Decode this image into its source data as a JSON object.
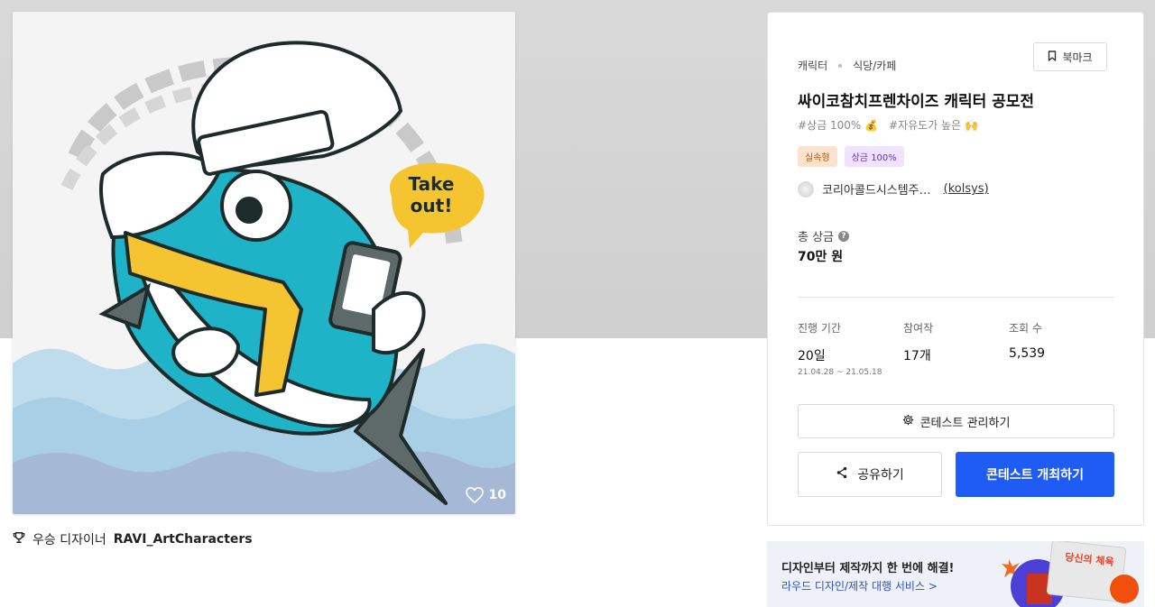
{
  "artwork": {
    "speech_bubble": "Take\nout!",
    "like_count": "10"
  },
  "winner": {
    "label": "우승 디자이너",
    "name": "RAVI_ArtCharacters"
  },
  "panel": {
    "categories": [
      "캐릭터",
      "식당/카페"
    ],
    "bookmark_label": "북마크",
    "title": "싸이코참치프렌차이즈 캐릭터 공모전",
    "hashtags": [
      "#상금 100% 💰",
      "#자유도가 높은 🙌"
    ],
    "badges": [
      "실속형",
      "상금 100%"
    ],
    "host": {
      "name": "코리아콜드시스템주…",
      "id": "(kolsys)"
    },
    "prize": {
      "label": "총 상금",
      "help": "?",
      "value": "70만 원"
    },
    "stats": [
      {
        "label": "진행 기간",
        "value": "20일",
        "sub": "21.04.28 ~ 21.05.18"
      },
      {
        "label": "참여작",
        "value": "17개",
        "sub": ""
      },
      {
        "label": "조회 수",
        "value": "5,539",
        "sub": ""
      }
    ],
    "manage_label": "콘테스트 관리하기",
    "share_label": "공유하기",
    "host_contest_label": "콘테스트 개최하기"
  },
  "ad": {
    "headline": "디자인부터 제작까지 한 번에 해결!",
    "link": "라우드 디자인/제작 대행 서비스 >",
    "image_text": "당신의 체육"
  },
  "colors": {
    "primary": "#1f5bf5",
    "tuna_teal": "#1fb3c8",
    "scarf_yellow": "#f5c531",
    "wave_blue": "#a9cfe6"
  }
}
